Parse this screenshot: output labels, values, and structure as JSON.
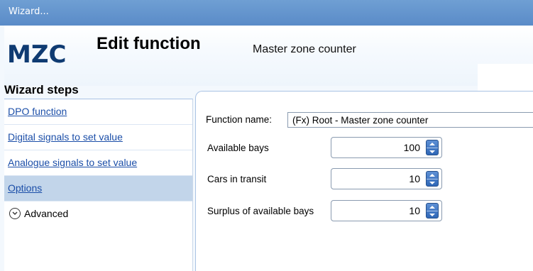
{
  "window": {
    "title": "Wizard..."
  },
  "header": {
    "logo": "MZC",
    "title": "Edit function",
    "subtitle": "Master zone counter"
  },
  "wizard_steps": {
    "title": "Wizard steps",
    "items": [
      {
        "label": "DPO function",
        "active": false
      },
      {
        "label": "Digital signals to set value",
        "active": false
      },
      {
        "label": "Analogue signals to set value",
        "active": false
      },
      {
        "label": "Options",
        "active": true
      }
    ],
    "advanced_label": "Advanced"
  },
  "form": {
    "function_name_label": "Function name:",
    "function_name_value": "(Fx) Root - Master zone counter",
    "fields": [
      {
        "label": "Available bays",
        "value": "100"
      },
      {
        "label": "Cars in transit",
        "value": "10"
      },
      {
        "label": "Surplus of available bays",
        "value": "10"
      }
    ]
  },
  "colors": {
    "titlebar": "#5a8bc8",
    "logo": "#0f3b72",
    "link": "#1b4ea8",
    "active_step": "#c2d5ea",
    "spin_button": "#2f67b7"
  }
}
